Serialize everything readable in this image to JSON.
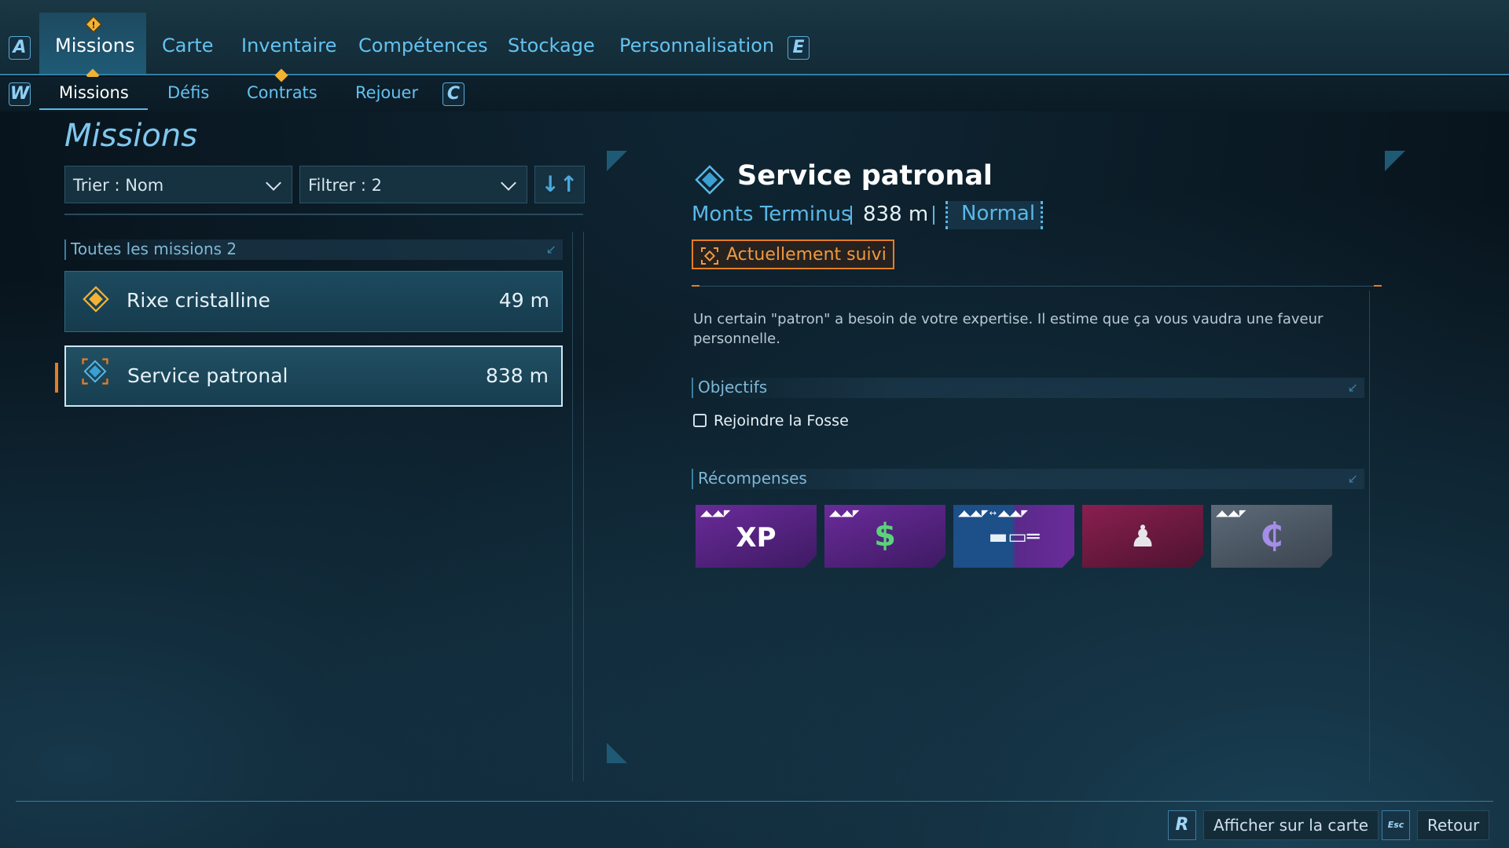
{
  "nav": {
    "key_left": "A",
    "key_right": "E",
    "tabs": [
      "Missions",
      "Carte",
      "Inventaire",
      "Compétences",
      "Stockage",
      "Personnalisation"
    ],
    "active_tab": "Missions"
  },
  "subnav": {
    "key_left": "W",
    "key_right": "C",
    "tabs": [
      "Missions",
      "Défis",
      "Contrats",
      "Rejouer"
    ],
    "active_tab": "Missions"
  },
  "left": {
    "title": "Missions",
    "sort_label": "Trier : Nom",
    "filter_label": "Filtrer : 2",
    "section_label": "Toutes les missions 2",
    "missions": [
      {
        "name": "Rixe cristalline",
        "distance": "49 m"
      },
      {
        "name": "Service patronal",
        "distance": "838 m"
      }
    ]
  },
  "detail": {
    "title": "Service patronal",
    "location": "Monts Terminus",
    "distance": "838 m",
    "difficulty": "Normal",
    "tracked_label": "Actuellement suivi",
    "description": "Un certain \"patron\" a besoin de votre expertise. Il estime que ça vous vaudra une faveur personnelle.",
    "objectives_label": "Objectifs",
    "objectives": [
      "Rejoindre la Fosse"
    ],
    "rewards_label": "Récompenses",
    "rewards": [
      {
        "icon": "xp-icon",
        "glyph": "XP"
      },
      {
        "icon": "money-icon",
        "glyph": "$"
      },
      {
        "icon": "shotgun-icon",
        "glyph": "▬▭═"
      },
      {
        "icon": "emote-icon",
        "glyph": "♟"
      },
      {
        "icon": "currency-icon",
        "glyph": "₵"
      }
    ]
  },
  "footer": {
    "map_key": "R",
    "map_label": "Afficher sur la carte",
    "back_key": "Esc",
    "back_label": "Retour"
  },
  "colors": {
    "accent_blue": "#63c2f0",
    "tracked_orange": "#e67d24",
    "mission_orange": "#f2b233"
  }
}
